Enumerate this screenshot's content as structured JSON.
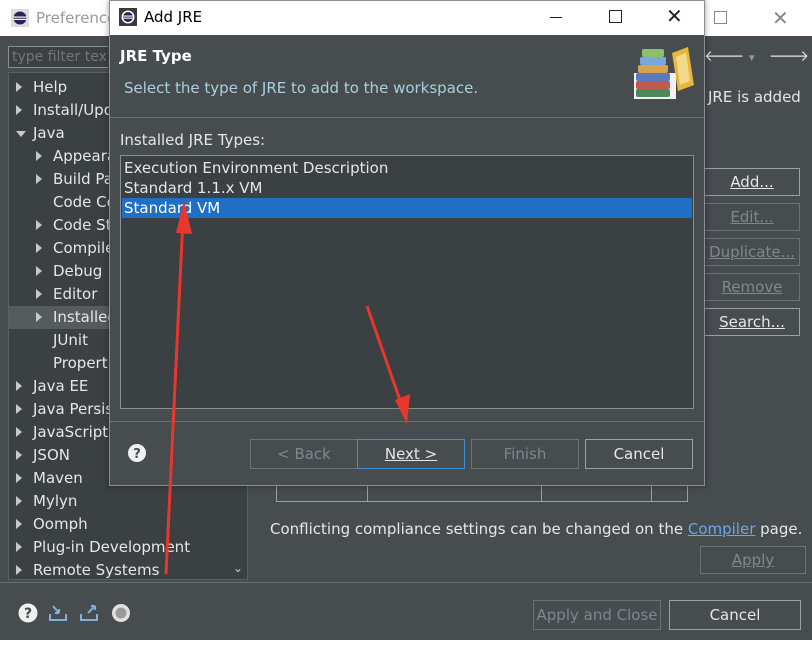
{
  "preferences": {
    "title": "Preferences",
    "filter_placeholder": "type filter text",
    "tree": [
      {
        "label": "Help",
        "arrow": "right",
        "level": 0
      },
      {
        "label": "Install/Update",
        "arrow": "right",
        "level": 0
      },
      {
        "label": "Java",
        "arrow": "down",
        "level": 0
      },
      {
        "label": "Appearance",
        "arrow": "right",
        "level": 1
      },
      {
        "label": "Build Path",
        "arrow": "right",
        "level": 1
      },
      {
        "label": "Code Coverage",
        "arrow": "none",
        "level": 1
      },
      {
        "label": "Code Style",
        "arrow": "right",
        "level": 1
      },
      {
        "label": "Compiler",
        "arrow": "right",
        "level": 1
      },
      {
        "label": "Debug",
        "arrow": "right",
        "level": 1
      },
      {
        "label": "Editor",
        "arrow": "right",
        "level": 1
      },
      {
        "label": "Installed JREs",
        "arrow": "right",
        "level": 1,
        "selected": true
      },
      {
        "label": "JUnit",
        "arrow": "none",
        "level": 1
      },
      {
        "label": "Properties Files Editor",
        "arrow": "none",
        "level": 1
      },
      {
        "label": "Java EE",
        "arrow": "right",
        "level": 0
      },
      {
        "label": "Java Persistence",
        "arrow": "right",
        "level": 0
      },
      {
        "label": "JavaScript",
        "arrow": "right",
        "level": 0
      },
      {
        "label": "JSON",
        "arrow": "right",
        "level": 0
      },
      {
        "label": "Maven",
        "arrow": "right",
        "level": 0
      },
      {
        "label": "Mylyn",
        "arrow": "right",
        "level": 0
      },
      {
        "label": "Oomph",
        "arrow": "right",
        "level": 0
      },
      {
        "label": "Plug-in Development",
        "arrow": "right",
        "level": 0
      },
      {
        "label": "Remote Systems",
        "arrow": "right",
        "level": 0
      }
    ],
    "jre_added_text": "JRE is added",
    "side_buttons": {
      "add": "Add...",
      "edit": "Edit...",
      "duplicate": "Duplicate...",
      "remove": "Remove",
      "search": "Search..."
    },
    "conflict_text": "Conflicting compliance settings can be changed on the ",
    "compiler_link": "Compiler",
    "conflict_suffix": " page.",
    "apply_label": "Apply",
    "apply_close_label": "Apply and Close",
    "cancel_label": "Cancel"
  },
  "dialog": {
    "title": "Add JRE",
    "heading": "JRE Type",
    "subtext": "Select the type of JRE to add to the workspace.",
    "list_label": "Installed JRE Types:",
    "jre_types": [
      {
        "label": "Execution Environment Description",
        "selected": false
      },
      {
        "label": "Standard 1.1.x VM",
        "selected": false
      },
      {
        "label": "Standard VM",
        "selected": true
      }
    ],
    "buttons": {
      "back": "< Back",
      "next": "Next >",
      "finish": "Finish",
      "cancel": "Cancel"
    }
  },
  "colors": {
    "background": "#474c4f",
    "selection": "#1f6fc6",
    "link": "#6aa8e8",
    "annotation_arrow": "#e8372c"
  }
}
